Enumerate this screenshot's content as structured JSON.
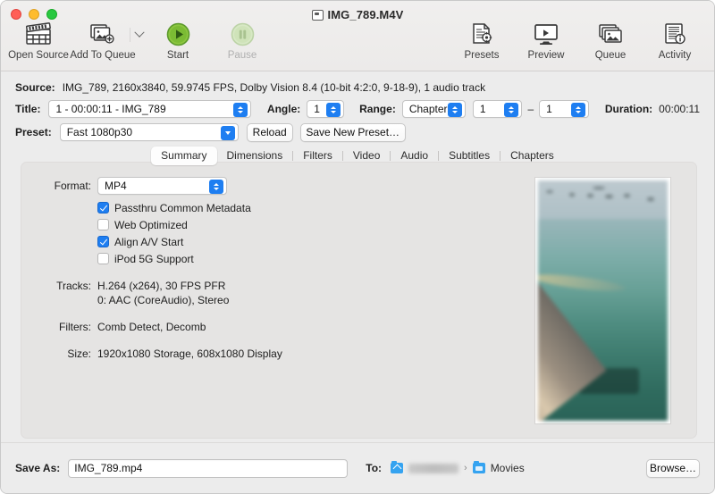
{
  "window": {
    "title": "IMG_789.M4V",
    "traffic_lights": [
      "close",
      "minimize",
      "zoom"
    ]
  },
  "toolbar": {
    "left_items": [
      {
        "label": "Open Source",
        "icon": "clapperboard-icon",
        "enabled": true
      },
      {
        "label": "Add To Queue",
        "icon": "add-to-queue-icon",
        "enabled": true
      },
      {
        "label": "Start",
        "icon": "play-icon",
        "enabled": true
      },
      {
        "label": "Pause",
        "icon": "pause-icon",
        "enabled": false
      }
    ],
    "right_items": [
      {
        "label": "Presets",
        "icon": "presets-icon"
      },
      {
        "label": "Preview",
        "icon": "preview-monitor-icon"
      },
      {
        "label": "Queue",
        "icon": "queue-stack-icon"
      },
      {
        "label": "Activity",
        "icon": "activity-log-icon"
      }
    ]
  },
  "source": {
    "label": "Source:",
    "value": "IMG_789, 2160x3840, 59.9745 FPS, Dolby Vision 8.4 (10-bit 4:2:0, 9-18-9), 1 audio track"
  },
  "title_row": {
    "title_label": "Title:",
    "title_value": "1 - 00:00:11 - IMG_789",
    "angle_label": "Angle:",
    "angle_value": "1",
    "range_label": "Range:",
    "range_type": "Chapters",
    "range_start": "1",
    "range_dash": "–",
    "range_end": "1",
    "duration_label": "Duration:",
    "duration_value": "00:00:11"
  },
  "preset_row": {
    "label": "Preset:",
    "value": "Fast 1080p30",
    "reload_label": "Reload",
    "save_label": "Save New Preset…"
  },
  "tabs": {
    "items": [
      "Summary",
      "Dimensions",
      "Filters",
      "Video",
      "Audio",
      "Subtitles",
      "Chapters"
    ],
    "active": "Summary"
  },
  "summary": {
    "format_label": "Format:",
    "format_value": "MP4",
    "checkboxes": [
      {
        "label": "Passthru Common Metadata",
        "checked": true
      },
      {
        "label": "Web Optimized",
        "checked": false
      },
      {
        "label": "Align A/V Start",
        "checked": true
      },
      {
        "label": "iPod 5G Support",
        "checked": false
      }
    ],
    "tracks_label": "Tracks:",
    "tracks_line1": "H.264 (x264), 30 FPS PFR",
    "tracks_line2": "0: AAC (CoreAudio), Stereo",
    "filters_label": "Filters:",
    "filters_value": "Comb Detect, Decomb",
    "size_label": "Size:",
    "size_value": "1920x1080 Storage, 608x1080 Display"
  },
  "preview": {
    "alt": "blurred still of teal ocean water seen over a wooden boat deck"
  },
  "bottom": {
    "save_as_label": "Save As:",
    "save_as_value": "IMG_789.mp4",
    "to_label": "To:",
    "path_home": "",
    "path_separator": "›",
    "path_folder": "Movies",
    "browse_label": "Browse…"
  },
  "colors": {
    "accent_blue": "#1e7ef1",
    "start_green": "#6cb33f",
    "window_bg": "#ececec",
    "panel_bg": "#e5e4e3",
    "folder_blue": "#35a3f0"
  }
}
